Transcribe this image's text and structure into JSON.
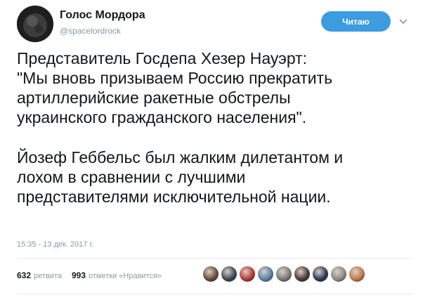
{
  "user": {
    "display_name": "Голос Мордора",
    "handle": "@spacelordrock",
    "follow_label": "Читаю"
  },
  "tweet": {
    "lines": [
      "Представитель Госдепа Хезер Науэрт:",
      "\"Мы вновь призываем Россию прекратить",
      "артиллерийские ракетные обстрелы",
      "украинского гражданского населения\".",
      "Йозеф Геббельс был жалким дилетантом и",
      "лохом в сравнении с лучшими",
      "представителями исключительной нации."
    ],
    "timestamp": "15:35 - 13 дек. 2017 г."
  },
  "stats": {
    "retweets_count": "632",
    "retweets_label": "ретвита",
    "likes_count": "993",
    "likes_label": "отметки «Нравится»"
  },
  "icons": {
    "caret": "chevron-down-icon"
  },
  "colors": {
    "follow_button": "#3d9be0",
    "meta_text": "#8899a6"
  },
  "likers": [
    {
      "color": "#6b4a3a"
    },
    {
      "color": "#3a4a5a"
    },
    {
      "color": "#b23a3a"
    },
    {
      "color": "#5a7fa8"
    },
    {
      "color": "#7a7a7a"
    },
    {
      "color": "#4a3a3a"
    },
    {
      "color": "#2a3a5a"
    },
    {
      "color": "#8a8a8a"
    },
    {
      "color": "#c07a4a"
    }
  ]
}
